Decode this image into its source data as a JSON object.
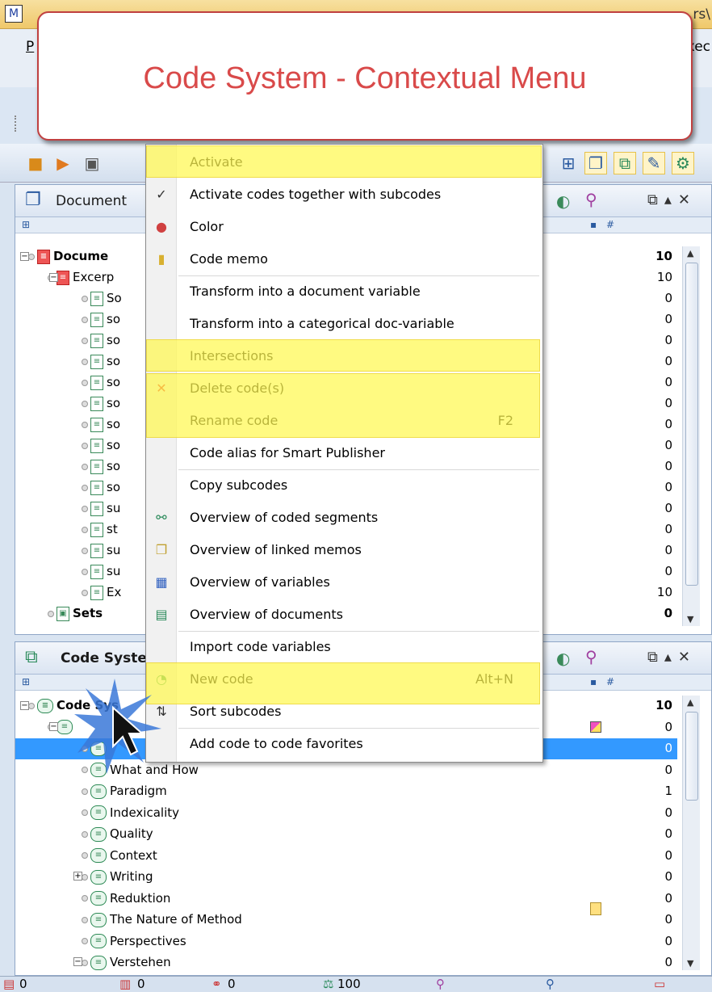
{
  "window": {
    "title_fragment": "rs\\",
    "menu_first": "P",
    "menu_last": "xec"
  },
  "callout": {
    "text": "Code System - Contextual Menu"
  },
  "document_panel": {
    "title": "Document",
    "rows": [
      {
        "label": "Docume",
        "num": "10",
        "bold": true
      },
      {
        "label": "Excerp",
        "num": "10"
      },
      {
        "label": "So",
        "num": "0"
      },
      {
        "label": "so",
        "num": "0"
      },
      {
        "label": "so",
        "num": "0"
      },
      {
        "label": "so",
        "num": "0"
      },
      {
        "label": "so",
        "num": "0"
      },
      {
        "label": "so",
        "num": "0"
      },
      {
        "label": "so",
        "num": "0"
      },
      {
        "label": "so",
        "num": "0"
      },
      {
        "label": "so",
        "num": "0"
      },
      {
        "label": "so",
        "num": "0"
      },
      {
        "label": "su",
        "num": "0"
      },
      {
        "label": "st",
        "num": "0"
      },
      {
        "label": "su",
        "num": "0"
      },
      {
        "label": "su",
        "num": "0"
      },
      {
        "label": "Ex",
        "num": "10"
      },
      {
        "label": "Sets",
        "num": "0",
        "bold": true
      }
    ]
  },
  "code_panel": {
    "title": "Code Syste",
    "rows": [
      {
        "label": "Code Sys",
        "num": "10",
        "bold": true
      },
      {
        "label": "",
        "num": "0"
      },
      {
        "label": "",
        "num": "0",
        "selected": true
      },
      {
        "label": "What and How",
        "num": "0"
      },
      {
        "label": "Paradigm",
        "num": "1"
      },
      {
        "label": "Indexicality",
        "num": "0"
      },
      {
        "label": "Quality",
        "num": "0"
      },
      {
        "label": "Context",
        "num": "0"
      },
      {
        "label": "Writing",
        "num": "0"
      },
      {
        "label": "Reduktion",
        "num": "0"
      },
      {
        "label": "The Nature of Method",
        "num": "0"
      },
      {
        "label": "Perspectives",
        "num": "0"
      },
      {
        "label": "Verstehen",
        "num": "0"
      }
    ]
  },
  "menu": {
    "items": [
      {
        "label": "Activate",
        "shortcut": "",
        "icon": "activate"
      },
      {
        "label": "Activate codes together with subcodes",
        "shortcut": "",
        "icon": "checkmark-icon"
      },
      {
        "label": "Color",
        "shortcut": "",
        "icon": "color-palette-icon"
      },
      {
        "label": "Code memo",
        "shortcut": "",
        "icon": "memo-icon"
      },
      {
        "label": "Transform into a document variable",
        "shortcut": "",
        "icon": ""
      },
      {
        "label": "Transform into a categorical doc-variable",
        "shortcut": "",
        "icon": ""
      },
      {
        "label": "Intersections",
        "shortcut": "",
        "icon": ""
      },
      {
        "label": "Delete code(s)",
        "shortcut": "",
        "icon": "delete-x-icon"
      },
      {
        "label": "Rename code",
        "shortcut": "F2",
        "icon": ""
      },
      {
        "label": "Code alias for Smart Publisher",
        "shortcut": "",
        "icon": ""
      },
      {
        "label": "Copy subcodes",
        "shortcut": "",
        "icon": ""
      },
      {
        "label": "Overview of coded segments",
        "shortcut": "",
        "icon": "coded-segments-icon"
      },
      {
        "label": "Overview of linked memos",
        "shortcut": "",
        "icon": "linked-memos-icon"
      },
      {
        "label": "Overview of variables",
        "shortcut": "",
        "icon": "variables-grid-icon"
      },
      {
        "label": "Overview of documents",
        "shortcut": "",
        "icon": "documents-icon"
      },
      {
        "label": "Import code variables",
        "shortcut": "",
        "icon": ""
      },
      {
        "label": "New code",
        "shortcut": "Alt+N",
        "icon": "new-code-icon"
      },
      {
        "label": "Sort subcodes",
        "shortcut": "",
        "icon": "sort-az-icon"
      },
      {
        "label": "Add code to code favorites",
        "shortcut": "",
        "icon": ""
      }
    ]
  },
  "statusbar": {
    "items": [
      "0",
      "0",
      "0",
      "100",
      "",
      "",
      ""
    ]
  },
  "colors": {
    "highlight": "#fff850",
    "selection": "#3399ff",
    "callout_text": "#d94a4a"
  }
}
